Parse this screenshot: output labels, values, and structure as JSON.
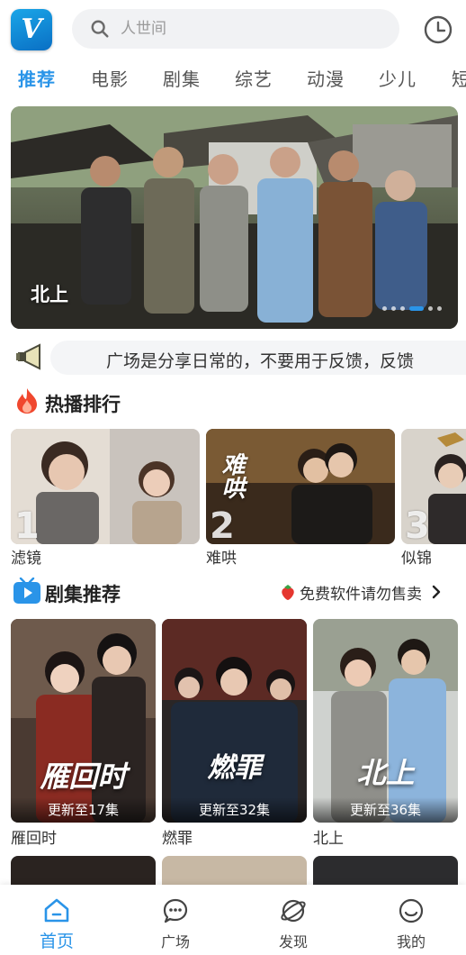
{
  "app": {
    "logo_letter": "V",
    "brand_color": "#2a94e8"
  },
  "search": {
    "placeholder": "人世间"
  },
  "tabs": [
    {
      "label": "推荐",
      "active": true
    },
    {
      "label": "电影"
    },
    {
      "label": "剧集"
    },
    {
      "label": "综艺"
    },
    {
      "label": "动漫"
    },
    {
      "label": "少儿"
    },
    {
      "label": "短"
    }
  ],
  "banner": {
    "title": "北上",
    "slide_count": 6,
    "active_slide": 4
  },
  "notice": {
    "text": "广场是分享日常的，不要用于反馈，反馈"
  },
  "hot": {
    "title": "热播排行",
    "items": [
      {
        "rank": "1",
        "name": "滤镜"
      },
      {
        "rank": "2",
        "name": "难哄",
        "overlay_text": "难哄"
      },
      {
        "rank": "3",
        "name": "似锦"
      }
    ]
  },
  "drama": {
    "title": "剧集推荐",
    "more_label": "免费软件请勿售卖",
    "items": [
      {
        "name": "雁回时",
        "update": "更新至17集",
        "overlay_text": "雁回时"
      },
      {
        "name": "燃罪",
        "update": "更新至32集",
        "overlay_text": "燃罪"
      },
      {
        "name": "北上",
        "update": "更新至36集",
        "overlay_text": "北上"
      }
    ]
  },
  "nav": {
    "items": [
      {
        "label": "首页",
        "icon": "home-icon",
        "active": true
      },
      {
        "label": "广场",
        "icon": "chat-icon"
      },
      {
        "label": "发现",
        "icon": "planet-icon"
      },
      {
        "label": "我的",
        "icon": "smile-icon"
      }
    ]
  }
}
